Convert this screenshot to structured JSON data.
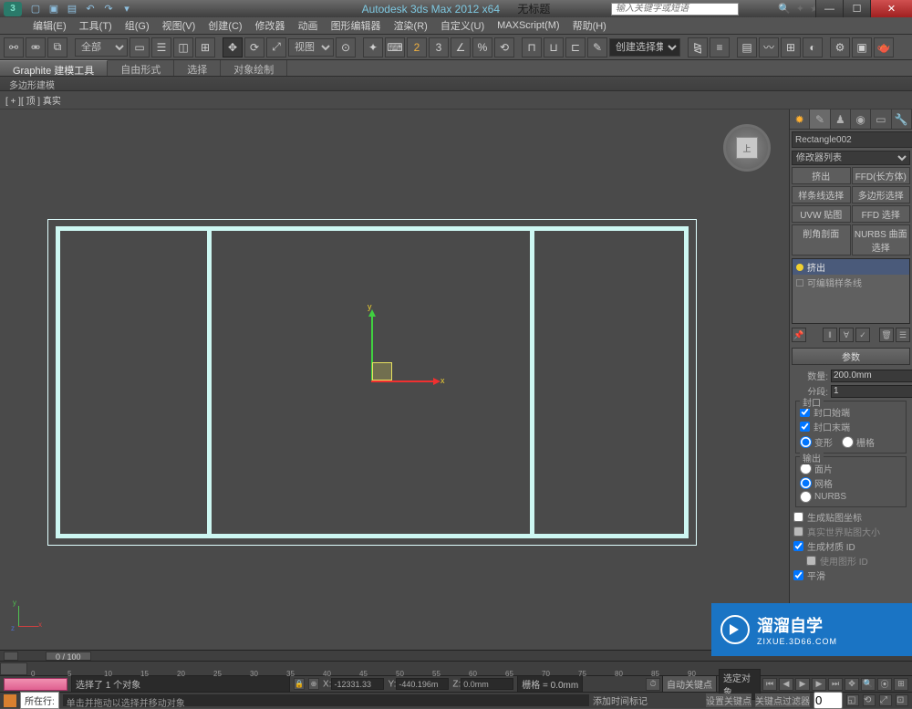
{
  "titlebar": {
    "app": "Autodesk 3ds Max  2012 x64",
    "untitled": "无标题",
    "search_placeholder": "输入关键字或短语"
  },
  "menubar": {
    "edit": "编辑(E)",
    "tools": "工具(T)",
    "group": "组(G)",
    "views": "视图(V)",
    "create": "创建(C)",
    "modifiers": "修改器",
    "animation": "动画",
    "graph": "图形编辑器",
    "rendering": "渲染(R)",
    "customize": "自定义(U)",
    "maxscript": "MAXScript(M)",
    "help": "帮助(H)"
  },
  "toolbar": {
    "all": "全部",
    "view": "视图",
    "selset_placeholder": "创建选择集"
  },
  "ribbon": {
    "graphite": "Graphite 建模工具",
    "freeform": "自由形式",
    "selection": "选择",
    "objpaint": "对象绘制",
    "poly": "多边形建模"
  },
  "viewport": {
    "label": "[ + ][ 顶 ] 真实",
    "axis_x": "x",
    "axis_y": "y",
    "mini_x": "x",
    "mini_y": "y",
    "mini_z": "z",
    "cube": "上"
  },
  "cmdpanel": {
    "objname": "Rectangle002",
    "modlist": "修改器列表",
    "btns": {
      "extrude": "挤出",
      "ffd": "FFD(长方体)",
      "splinesel": "样条线选择",
      "polysel": "多边形选择",
      "uvw": "UVW 贴图",
      "ffdsel": "FFD 选择",
      "chamfer": "削角剖面",
      "nurbs": "NURBS 曲面选择"
    },
    "stack": {
      "extrude": "挤出",
      "editspline": "可编辑样条线"
    },
    "rollout_params": "参数",
    "amount_lbl": "数量:",
    "amount_val": "200.0mm",
    "segs_lbl": "分段:",
    "segs_val": "1",
    "cap_group": "封口",
    "cap_start": "封口始端",
    "cap_end": "封口末端",
    "morph": "变形",
    "grid": "栅格",
    "output_group": "输出",
    "patch": "面片",
    "mesh": "网格",
    "nurbs_out": "NURBS",
    "gen_uv": "生成贴图坐标",
    "realworld": "真实世界贴图大小",
    "gen_mat": "生成材质 ID",
    "use_shape": "使用图形 ID",
    "smooth": "平滑"
  },
  "watermark": {
    "big": "溜溜自学",
    "sm": "ZIXUE.3D66.COM"
  },
  "timeline": {
    "pos": "0 / 100"
  },
  "ruler": [
    "0",
    "5",
    "10",
    "15",
    "20",
    "25",
    "30",
    "35",
    "40",
    "45",
    "50",
    "55",
    "60",
    "65",
    "70",
    "75",
    "80",
    "85",
    "90"
  ],
  "status": {
    "sel": "选择了 1 个对象",
    "x": "-12331.33",
    "y": "-440.196m",
    "z": "0.0mm",
    "grid": "栅格 = 0.0mm",
    "autokey": "自动关键点",
    "selset": "选定对象",
    "nowexec": "所在行:",
    "hint": "单击并拖动以选择并移动对象",
    "addtime": "添加时间标记",
    "setkey": "设置关键点",
    "keyfilter": "关键点过滤器"
  }
}
